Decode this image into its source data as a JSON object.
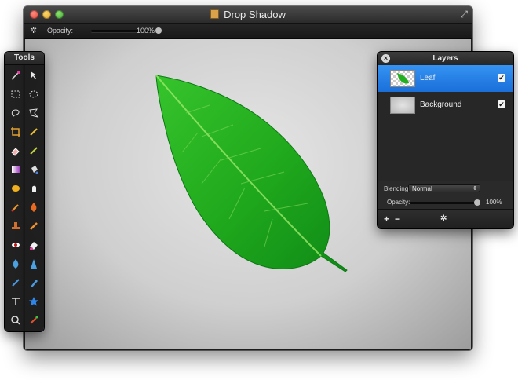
{
  "window": {
    "title": "Drop Shadow",
    "colors": {
      "window_bg": "#1c1c1c",
      "canvas_bg": "#cfcfcf",
      "selection": "#1a6fd9"
    }
  },
  "options_bar": {
    "gear_icon": "gear-icon",
    "opacity_label": "Opacity:",
    "opacity_value": "100%",
    "opacity_fraction": 1.0
  },
  "tools_panel": {
    "title": "Tools",
    "tools": [
      {
        "name": "magic-wand-tool",
        "icon": "magic-wand-icon"
      },
      {
        "name": "move-tool",
        "icon": "move-arrow-icon"
      },
      {
        "name": "rect-select-tool",
        "icon": "rect-select-icon"
      },
      {
        "name": "ellipse-select-tool",
        "icon": "ellipse-select-icon"
      },
      {
        "name": "lasso-tool",
        "icon": "lasso-icon"
      },
      {
        "name": "polygon-lasso-tool",
        "icon": "polygon-lasso-icon"
      },
      {
        "name": "crop-tool",
        "icon": "crop-icon"
      },
      {
        "name": "eyedropper-tool",
        "icon": "eyedropper-icon"
      },
      {
        "name": "eraser-tool",
        "icon": "eraser-icon"
      },
      {
        "name": "pencil-tool",
        "icon": "pencil-icon"
      },
      {
        "name": "gradient-tool",
        "icon": "gradient-icon"
      },
      {
        "name": "paint-bucket-tool",
        "icon": "paint-bucket-icon"
      },
      {
        "name": "sponge-tool",
        "icon": "sponge-icon"
      },
      {
        "name": "smudge-tool",
        "icon": "smudge-icon"
      },
      {
        "name": "brush-tool",
        "icon": "brush-icon"
      },
      {
        "name": "burn-tool",
        "icon": "burn-icon"
      },
      {
        "name": "stamp-tool",
        "icon": "stamp-icon"
      },
      {
        "name": "dodge-tool",
        "icon": "dodge-icon"
      },
      {
        "name": "red-eye-tool",
        "icon": "red-eye-icon"
      },
      {
        "name": "magic-eraser-tool",
        "icon": "magic-eraser-icon"
      },
      {
        "name": "blur-tool",
        "icon": "blur-drop-icon"
      },
      {
        "name": "sharpen-tool",
        "icon": "sharpen-icon"
      },
      {
        "name": "pen-tool",
        "icon": "pen-icon"
      },
      {
        "name": "vector-pen-tool",
        "icon": "vector-pen-icon"
      },
      {
        "name": "text-tool",
        "icon": "text-icon"
      },
      {
        "name": "shape-tool",
        "icon": "star-shape-icon"
      },
      {
        "name": "zoom-tool",
        "icon": "zoom-icon"
      },
      {
        "name": "color-picker-tool",
        "icon": "color-picker-icon"
      }
    ]
  },
  "layers_panel": {
    "title": "Layers",
    "layers": [
      {
        "name": "Leaf",
        "visible": true,
        "selected": true
      },
      {
        "name": "Background",
        "visible": true,
        "selected": false
      }
    ],
    "blending_label": "Blending:",
    "blending_value": "Normal",
    "opacity_label": "Opacity:",
    "opacity_value": "100%",
    "opacity_fraction": 1.0,
    "footer": {
      "add_label": "+",
      "remove_label": "−",
      "gear_label": "✲"
    }
  }
}
